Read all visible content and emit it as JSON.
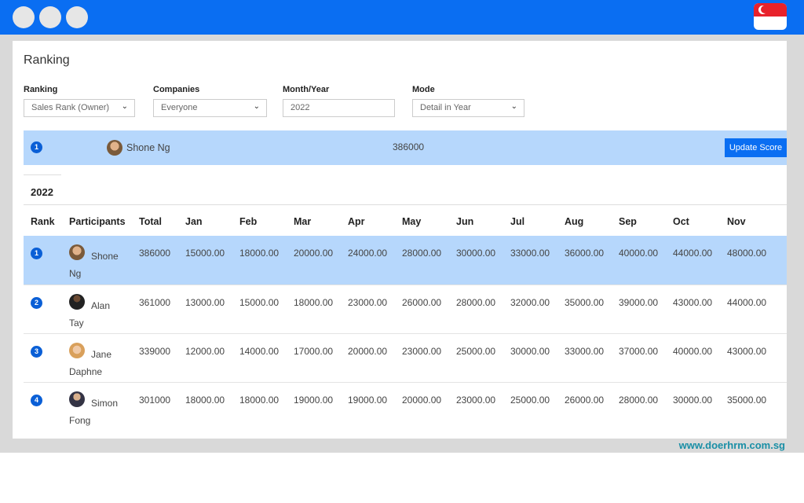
{
  "window": {
    "accent": "#0a6ef2",
    "flag": "singapore-flag-icon"
  },
  "page": {
    "title": "Ranking"
  },
  "filters": {
    "ranking": {
      "label": "Ranking",
      "value": "Sales Rank (Owner)"
    },
    "companies": {
      "label": "Companies",
      "value": "Everyone"
    },
    "month_year": {
      "label": "Month/Year",
      "value": "2022"
    },
    "mode": {
      "label": "Mode",
      "value": "Detail in Year"
    }
  },
  "leader": {
    "rank": "1",
    "name": "Shone Ng",
    "score": "386000",
    "button": "Update Score"
  },
  "year_tab": "2022",
  "table": {
    "headers": {
      "rank": "Rank",
      "participants": "Participants",
      "total": "Total",
      "jan": "Jan",
      "feb": "Feb",
      "mar": "Mar",
      "apr": "Apr",
      "may": "May",
      "jun": "Jun",
      "jul": "Jul",
      "aug": "Aug",
      "sep": "Sep",
      "oct": "Oct",
      "nov": "Nov"
    },
    "rows": [
      {
        "rank": "1",
        "name": "Shone Ng",
        "total": "386000",
        "months": [
          "15000.00",
          "18000.00",
          "20000.00",
          "24000.00",
          "28000.00",
          "30000.00",
          "33000.00",
          "36000.00",
          "40000.00",
          "44000.00",
          "48000.00"
        ]
      },
      {
        "rank": "2",
        "name": "Alan Tay",
        "total": "361000",
        "months": [
          "13000.00",
          "15000.00",
          "18000.00",
          "23000.00",
          "26000.00",
          "28000.00",
          "32000.00",
          "35000.00",
          "39000.00",
          "43000.00",
          "44000.00"
        ]
      },
      {
        "rank": "3",
        "name": "Jane Daphne",
        "total": "339000",
        "months": [
          "12000.00",
          "14000.00",
          "17000.00",
          "20000.00",
          "23000.00",
          "25000.00",
          "30000.00",
          "33000.00",
          "37000.00",
          "40000.00",
          "43000.00"
        ]
      },
      {
        "rank": "4",
        "name": "Simon Fong",
        "total": "301000",
        "months": [
          "18000.00",
          "18000.00",
          "19000.00",
          "19000.00",
          "20000.00",
          "23000.00",
          "25000.00",
          "26000.00",
          "28000.00",
          "30000.00",
          "35000.00"
        ]
      }
    ]
  },
  "footer": {
    "website": "www.doerhrm.com.sg"
  }
}
